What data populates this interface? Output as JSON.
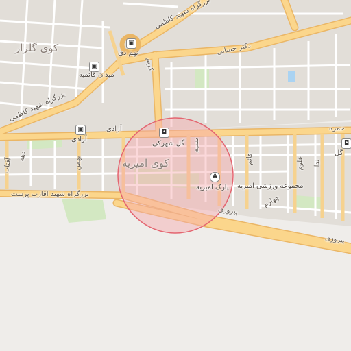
{
  "map": {
    "colors": {
      "background": "#efedea",
      "block": "#e2ded8",
      "street": "#ffffff",
      "major_road": "#fbd68c",
      "major_road_edge": "#eab666",
      "park": "#d3e8c2",
      "water": "#aad3f2",
      "circle_fill": "#f7a9ad",
      "circle_stroke": "#e46570"
    },
    "neighborhoods": {
      "golzar": "کوی گلزار",
      "amirieh": "کوی امیریه"
    },
    "roads": {
      "kazemi_top": "بزرگراه شهید کاظمی",
      "kazemi_left": "بزرگراه شهید کاظمی",
      "hasani": "دکتر حسانی",
      "azadi": "آزادی",
      "aqarebparast": "بزرگراه شهید اقارب پرست",
      "pirouzi": "پیروزی",
      "pirouzi_east": "پیروزی",
      "karim": "کریم",
      "daheh": "دهه",
      "bahman": "بهمن",
      "nasim": "نسیم",
      "aftab": "آفتاب",
      "ghaem": "قائم",
      "oloum": "علوم",
      "neda": "ندا",
      "chaharom": "چهارم",
      "hamzeh": "حمزه"
    },
    "pois": {
      "meydan_ghaemieh": "میدان قائمیه",
      "noh_dey": "نهم دی",
      "azadi_stop": "آزادی",
      "gol_shahrak": "گل شهرکی",
      "park_amirieh": "پارک امیریه",
      "sports_complex": "مجموعه ورزشی امیریه",
      "gol_east": "گل"
    },
    "icons": [
      "bus-icon",
      "shopping-bag-icon",
      "tree-icon"
    ]
  }
}
